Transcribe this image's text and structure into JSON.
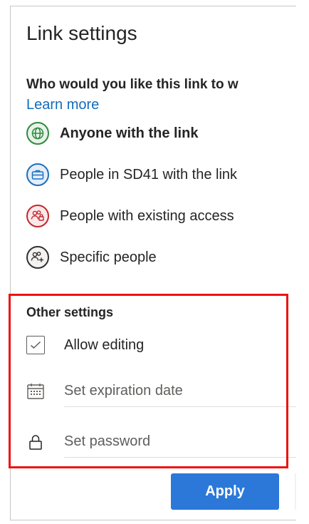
{
  "panel": {
    "title": "Link settings",
    "question": "Who would you like this link to w",
    "learn_more": "Learn more"
  },
  "options": [
    {
      "label": "Anyone with the link",
      "icon": "globe-icon",
      "color": "#2f8a3e",
      "bg": "#e6f3e8",
      "selected": true
    },
    {
      "label": "People in SD41 with the link",
      "icon": "briefcase-icon",
      "color": "#1d6fbf",
      "bg": "#e3eefa",
      "selected": false
    },
    {
      "label": "People with existing access",
      "icon": "people-lock-icon",
      "color": "#c4262e",
      "bg": "#fbe9ea",
      "selected": false
    },
    {
      "label": "Specific people",
      "icon": "people-add-icon",
      "color": "#323130",
      "bg": "#f3f2f1",
      "selected": false
    }
  ],
  "other_settings": {
    "title": "Other settings",
    "allow_editing": {
      "label": "Allow editing",
      "checked": true,
      "icon": "check-icon"
    },
    "expiration": {
      "placeholder": "Set expiration date",
      "icon": "calendar-icon"
    },
    "password": {
      "placeholder": "Set password",
      "icon": "lock-icon"
    }
  },
  "footer": {
    "apply_label": "Apply",
    "apply_color": "#2b78d9"
  },
  "highlight_color": "#ee1111"
}
